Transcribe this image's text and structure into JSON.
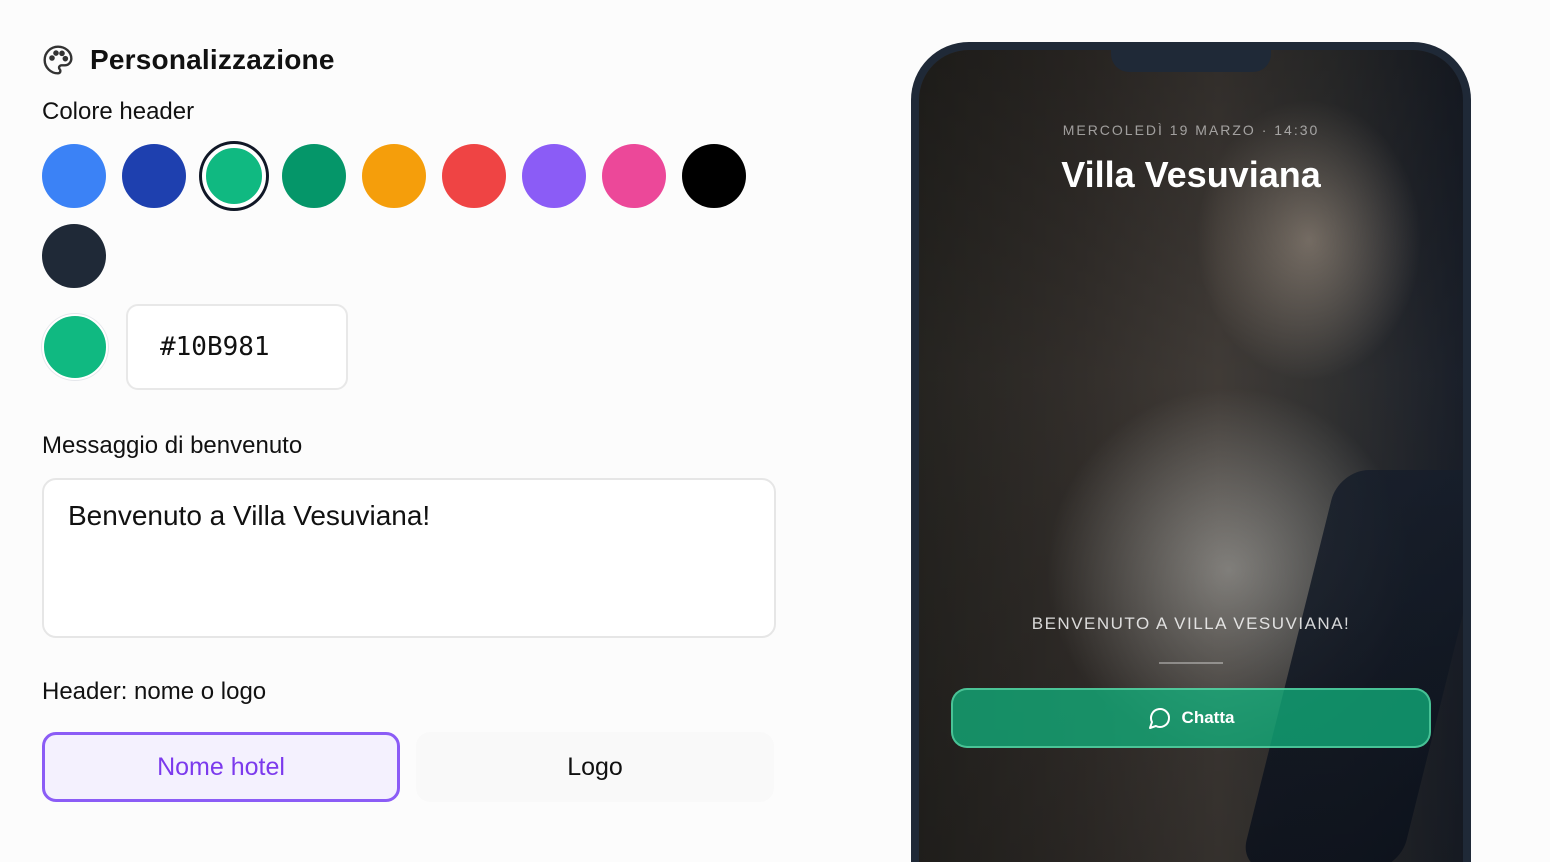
{
  "section": {
    "title": "Personalizzazione",
    "icon": "palette-icon"
  },
  "header_color": {
    "label": "Colore header",
    "swatches": [
      {
        "name": "blue",
        "color": "#3B82F6"
      },
      {
        "name": "dark-blue",
        "color": "#1E40AF"
      },
      {
        "name": "emerald",
        "color": "#10B981",
        "selected": true
      },
      {
        "name": "green",
        "color": "#059669"
      },
      {
        "name": "amber",
        "color": "#F59E0B"
      },
      {
        "name": "red",
        "color": "#EF4444"
      },
      {
        "name": "violet",
        "color": "#8B5CF6"
      },
      {
        "name": "pink",
        "color": "#EC4899"
      },
      {
        "name": "black",
        "color": "#000000"
      },
      {
        "name": "slate",
        "color": "#1F2937"
      }
    ],
    "custom_value": "#10B981"
  },
  "welcome_message": {
    "label": "Messaggio di benvenuto",
    "value": "Benvenuto a Villa Vesuviana!"
  },
  "header_mode": {
    "label": "Header: nome o logo",
    "options": [
      "Nome hotel",
      "Logo"
    ],
    "selected": "Nome hotel"
  },
  "preview": {
    "date_line": "MERCOLEDÌ 19 MARZO · 14:30",
    "hotel_name": "Villa Vesuviana",
    "welcome_text": "BENVENUTO A VILLA VESUVIANA!",
    "chat_label": "Chatta",
    "chat_icon": "chat-bubble-icon"
  },
  "colors": {
    "accent": "#8B5CF6",
    "selected_header": "#10B981"
  }
}
